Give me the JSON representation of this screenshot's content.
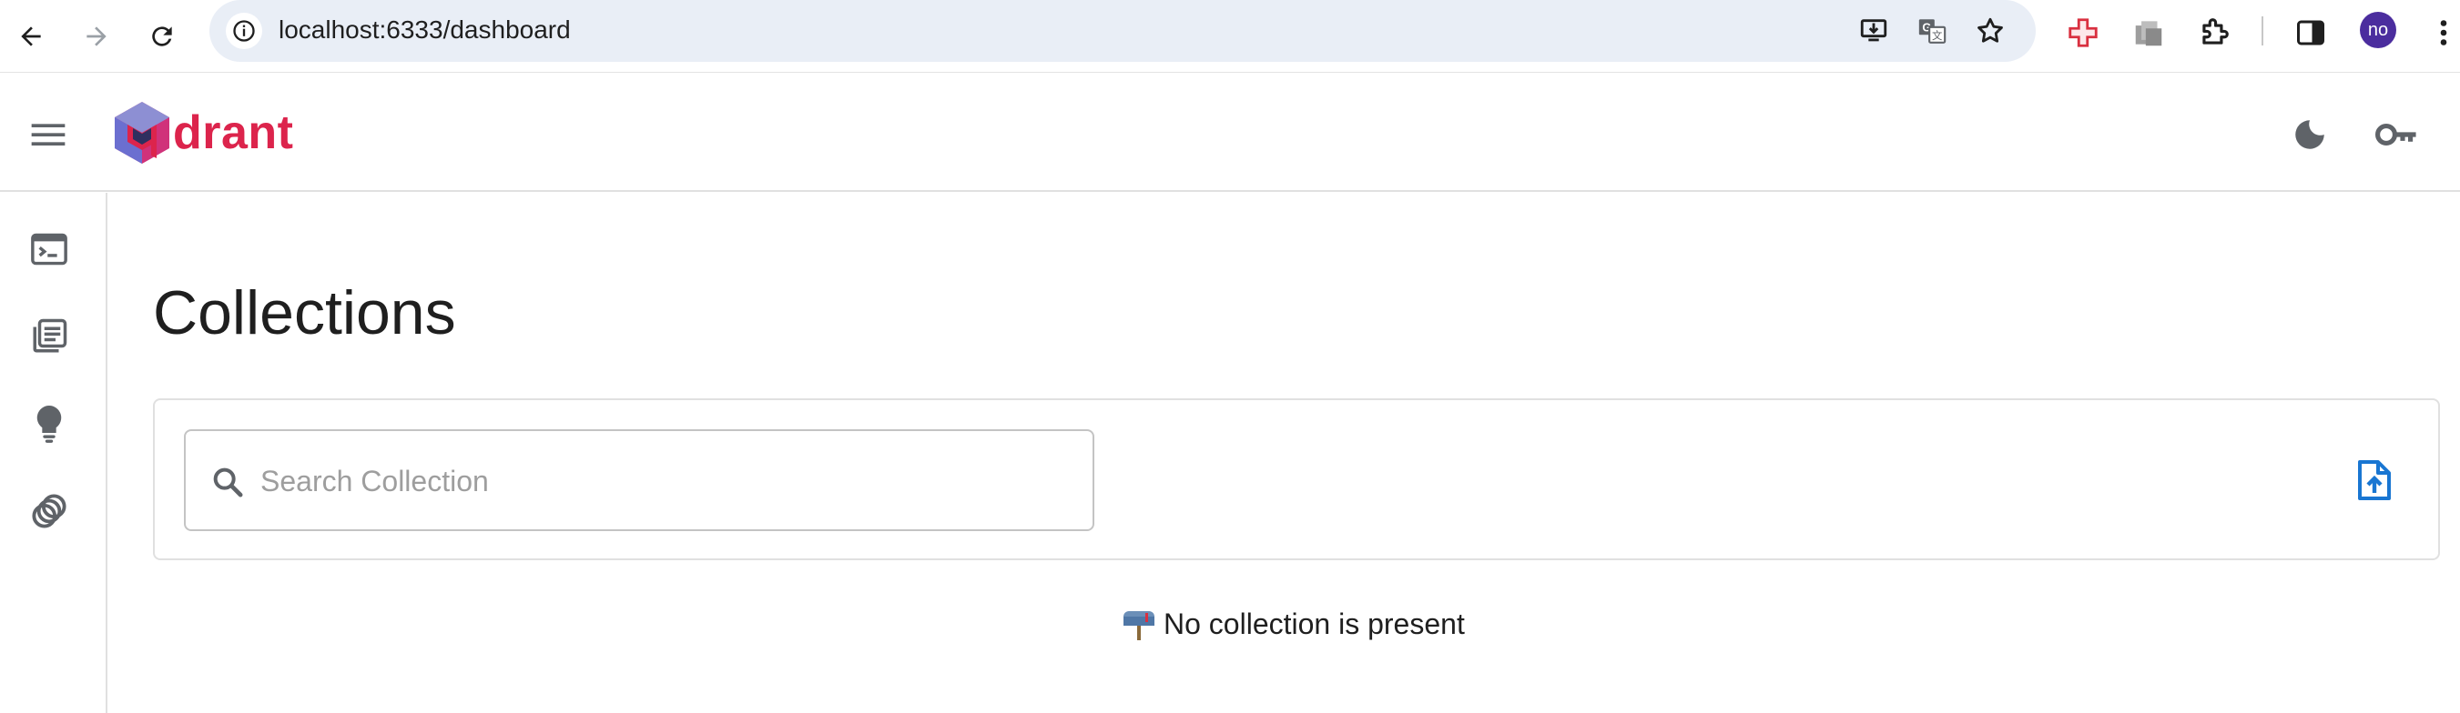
{
  "browser": {
    "url": "localhost:6333/dashboard",
    "profile_initials": "no"
  },
  "app": {
    "brand_name": "drant",
    "brand_color": "#dc244c"
  },
  "sidebar": {
    "items": [
      {
        "icon": "terminal-icon",
        "label": "Console"
      },
      {
        "icon": "collections-icon",
        "label": "Collections"
      },
      {
        "icon": "lightbulb-icon",
        "label": "Tutorial"
      },
      {
        "icon": "datasets-icon",
        "label": "Datasets"
      }
    ]
  },
  "main": {
    "title": "Collections",
    "search": {
      "placeholder": "Search Collection",
      "value": ""
    },
    "empty_message": "No collection is present"
  },
  "colors": {
    "accent_blue": "#1976d2",
    "icon_gray": "#5f6368"
  }
}
